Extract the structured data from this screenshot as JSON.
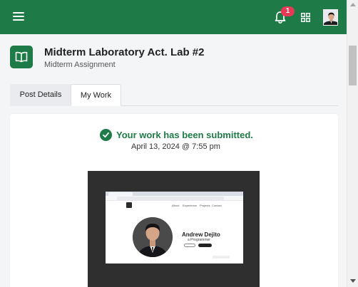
{
  "topbar": {
    "notification_count": "1",
    "accent_color": "#1e7b47",
    "badge_color": "#e53955",
    "icons": [
      "hamburger-menu-icon",
      "bell-icon",
      "apps-grid-icon",
      "user-avatar"
    ]
  },
  "post": {
    "icon": "book-icon",
    "title": "Midterm Laboratory Act. Lab #2",
    "subtitle": "Midterm Assignment"
  },
  "tabs": [
    {
      "label": "Post Details",
      "active": false
    },
    {
      "label": "My Work",
      "active": true
    }
  ],
  "submission": {
    "status_icon": "check-circle-icon",
    "status_text": "Your work has been submitted.",
    "submitted_at": "April 13, 2024 @ 7:55 pm"
  },
  "attachment": {
    "kind": "screenshot-thumbnail",
    "nav_items": [
      "About",
      "Experience",
      "Projects",
      "Contact"
    ],
    "name": "Andrew Dejito",
    "role": "a Programmer"
  }
}
